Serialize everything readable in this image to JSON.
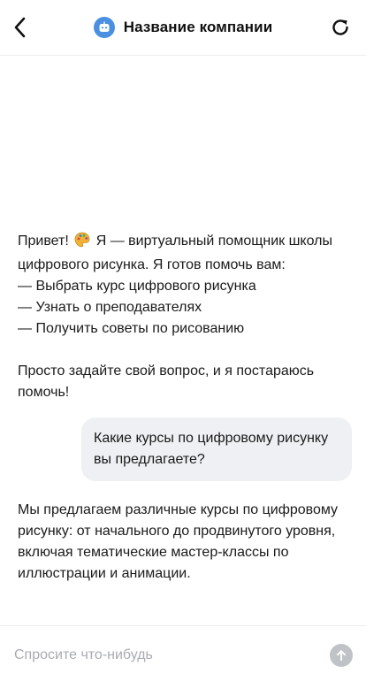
{
  "header": {
    "title": "Название компании"
  },
  "messages": {
    "bot_greeting_1": "Привет!",
    "bot_greeting_2": "Я — виртуальный помощник школы цифрового рисунка. Я готов помочь вам:\n— Выбрать курс цифрового рисунка\n— Узнать о преподавателях\n— Получить советы по рисованию\n\nПросто задайте свой вопрос, и я постараюсь помочь!",
    "user_question": "Какие курсы по цифровому рисунку вы предлагаете?",
    "bot_answer": "Мы предлагаем различные курсы по цифровому рисунку: от начального до продвинутого уровня, включая тематические мастер-классы по иллюстрации и анимации."
  },
  "composer": {
    "placeholder": "Спросите что-нибудь"
  },
  "icons": {
    "back": "chevron-left-icon",
    "bot": "bot-icon",
    "refresh": "refresh-icon",
    "emoji": "palette-emoji-icon",
    "send": "arrow-up-icon"
  },
  "colors": {
    "accent": "#4a8fe0",
    "user_bubble": "#eef0f3",
    "send_button": "#bfc3c8"
  }
}
